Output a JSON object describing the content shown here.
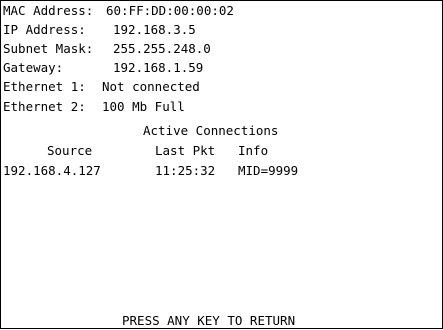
{
  "network": {
    "mac": {
      "label": "MAC Address:",
      "value": "60:FF:DD:00:00:02"
    },
    "ip": {
      "label": "IP Address:",
      "value": "192.168.3.5"
    },
    "subnet": {
      "label": "Subnet Mask:",
      "value": "255.255.248.0"
    },
    "gateway": {
      "label": "Gateway:",
      "value": "192.168.1.59"
    },
    "ethernet1": {
      "label": "Ethernet 1:",
      "value": "Not connected"
    },
    "ethernet2": {
      "label": "Ethernet 2:",
      "value": "100 Mb Full"
    }
  },
  "connections": {
    "title": "Active Connections",
    "columns": [
      "Source",
      "Last Pkt",
      "Info"
    ],
    "rows": [
      {
        "source": "192.168.4.127",
        "last_pkt": "11:25:32",
        "info": "MID=9999"
      }
    ]
  },
  "footer": {
    "prompt": "PRESS ANY KEY TO RETURN"
  }
}
